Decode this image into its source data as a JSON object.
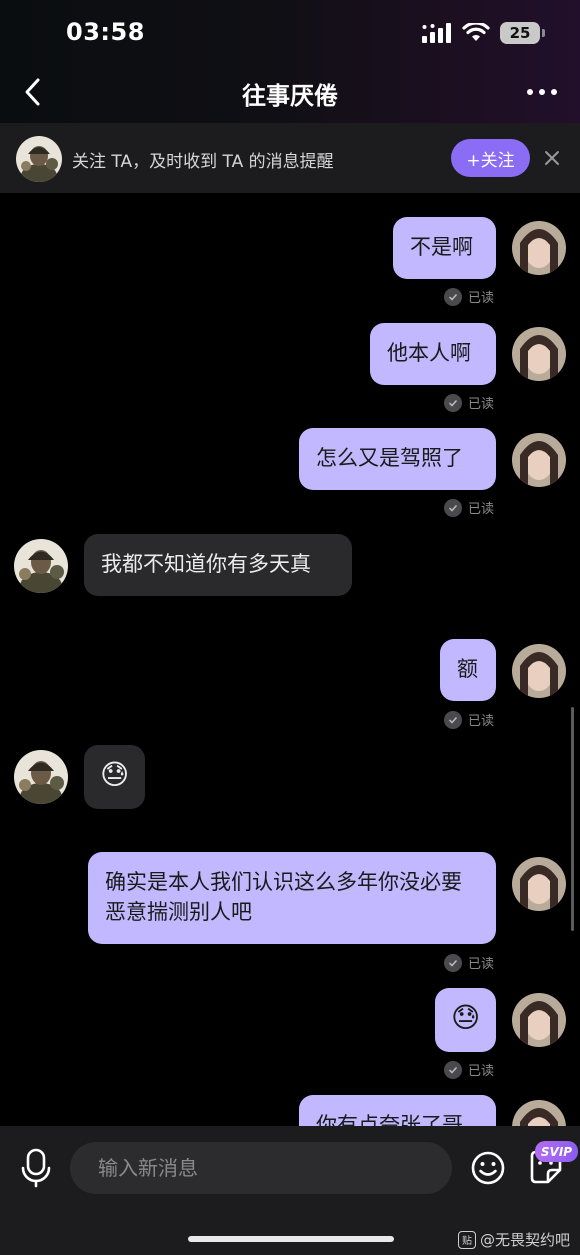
{
  "status_bar": {
    "time": "03:58",
    "battery": "25"
  },
  "nav": {
    "title": "往事厌倦"
  },
  "follow_banner": {
    "text": "关注 TA，及时收到 TA 的消息提醒",
    "button_label": "+关注"
  },
  "messages": [
    {
      "from": "me",
      "text": "不是啊",
      "status": "已读"
    },
    {
      "from": "me",
      "text": "他本人啊",
      "status": "已读"
    },
    {
      "from": "me",
      "text": "怎么又是驾照了",
      "status": "已读"
    },
    {
      "from": "them",
      "text": "我都不知道你有多天真"
    },
    {
      "from": "me",
      "text": "额",
      "status": "已读"
    },
    {
      "from": "them",
      "text": "😓"
    },
    {
      "from": "me",
      "text": "确实是本人我们认识这么多年你没必要恶意揣测别人吧",
      "status": "已读"
    },
    {
      "from": "me",
      "text": "😓",
      "status": "已读"
    },
    {
      "from": "me",
      "text": "你有点夸张了哥"
    }
  ],
  "input": {
    "placeholder": "输入新消息",
    "svip_badge": "SVIP"
  },
  "watermark": {
    "icon": "贴",
    "text": "@无畏契约吧"
  }
}
